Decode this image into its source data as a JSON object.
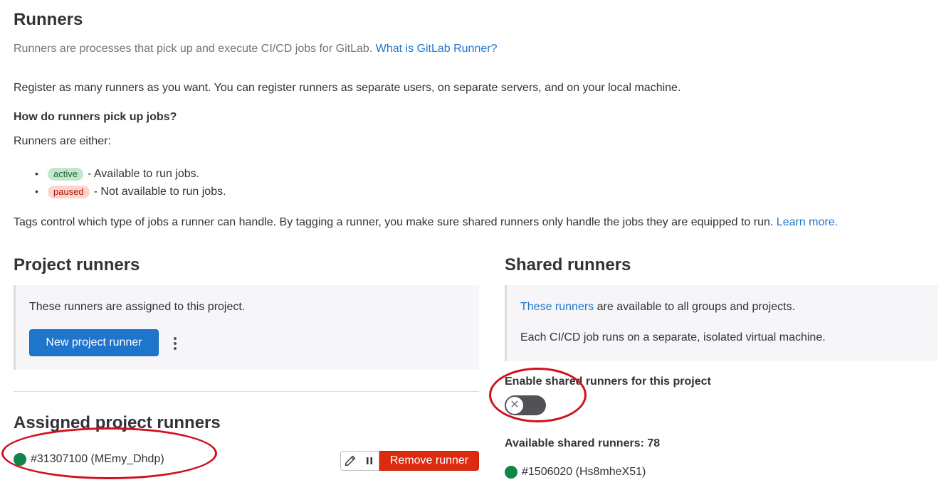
{
  "header": {
    "title": "Runners",
    "subtitle": "Runners are processes that pick up and execute CI/CD jobs for GitLab.",
    "subtitle_link": "What is GitLab Runner?"
  },
  "intro": {
    "register_text": "Register as many runners as you want. You can register runners as separate users, on separate servers, and on your local machine.",
    "question": "How do runners pick up jobs?",
    "either": "Runners are either:",
    "states": [
      {
        "badge": "active",
        "description": "- Available to run jobs."
      },
      {
        "badge": "paused",
        "description": "- Not available to run jobs."
      }
    ],
    "tags_text": "Tags control which type of jobs a runner can handle. By tagging a runner, you make sure shared runners only handle the jobs they are equipped to run.",
    "tags_link": "Learn more."
  },
  "project_runners": {
    "title": "Project runners",
    "card_text": "These runners are assigned to this project.",
    "new_button": "New project runner",
    "assigned_title": "Assigned project runners",
    "runner": {
      "id_name": "#31307100 (MEmy_Dhdp)",
      "status_color": "#108548",
      "edit_icon": "pencil-icon",
      "pause_icon": "pause-icon",
      "remove_button": "Remove runner"
    }
  },
  "shared_runners": {
    "title": "Shared runners",
    "card_link": "These runners",
    "card_text_rest": "are available to all groups and projects.",
    "card_text2": "Each CI/CD job runs on a separate, isolated virtual machine.",
    "toggle_label": "Enable shared runners for this project",
    "toggle_enabled": false,
    "available_label": "Available shared runners: 78",
    "runner": {
      "id_name": "#1506020 (Hs8mheX51)",
      "status_color": "#108548"
    }
  },
  "colors": {
    "link": "#1f75cb",
    "primary": "#1f75cb",
    "danger": "#dd2b0e",
    "annotation": "#d0101d"
  }
}
